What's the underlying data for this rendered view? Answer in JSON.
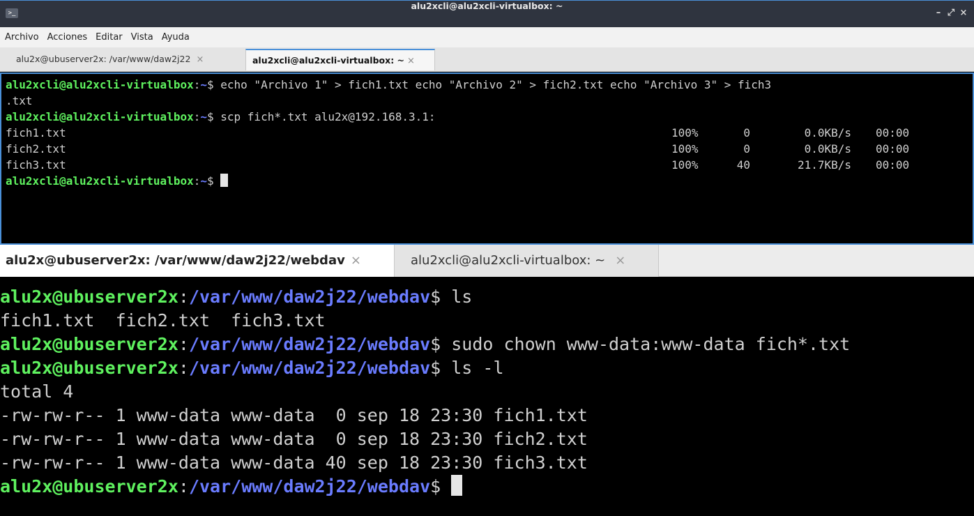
{
  "window1": {
    "title": "alu2xcli@alu2xcli-virtualbox: ~",
    "app_icon_text": ">_",
    "controls": {
      "minimize": "–",
      "maximize": "⤢",
      "close": "×"
    },
    "menu": [
      "Archivo",
      "Acciones",
      "Editar",
      "Vista",
      "Ayuda"
    ],
    "tabs": [
      {
        "label": "alu2x@ubuserver2x: /var/www/daw2j22",
        "active": false
      },
      {
        "label": "alu2xcli@alu2xcli-virtualbox: ~",
        "active": true
      }
    ],
    "tab_close": "×",
    "terminal": {
      "prompt_user": "alu2xcli@alu2xcli-virtualbox",
      "prompt_path": "~",
      "prompt_sep": ":",
      "prompt_end": "$ ",
      "cmd1": "echo \"Archivo 1\" > fich1.txt echo \"Archivo 2\" > fich2.txt echo \"Archivo 3\" > fich3",
      "cmd1_wrap": ".txt",
      "cmd2": "scp fich*.txt alu2x@192.168.3.1:",
      "transfers": [
        {
          "file": "fich1.txt",
          "pct": "100%",
          "bytes": "0",
          "rate": "0.0KB/s",
          "time": "00:00"
        },
        {
          "file": "fich2.txt",
          "pct": "100%",
          "bytes": "0",
          "rate": "0.0KB/s",
          "time": "00:00"
        },
        {
          "file": "fich3.txt",
          "pct": "100%",
          "bytes": "40",
          "rate": "21.7KB/s",
          "time": "00:00"
        }
      ]
    }
  },
  "window2": {
    "tabs": [
      {
        "label": "alu2x@ubuserver2x: /var/www/daw2j22/webdav",
        "active": true
      },
      {
        "label": "alu2xcli@alu2xcli-virtualbox: ~",
        "active": false
      }
    ],
    "tab_close": "×",
    "terminal": {
      "prompt_user": "alu2x@ubuserver2x",
      "prompt_sep": ":",
      "prompt_path": "/var/www/daw2j22/webdav",
      "prompt_end": "$ ",
      "cmd1": "ls",
      "ls_output": "fich1.txt  fich2.txt  fich3.txt",
      "cmd2": "sudo chown www-data:www-data fich*.txt",
      "cmd3": "ls -l",
      "total": "total 4",
      "listing": [
        "-rw-rw-r-- 1 www-data www-data  0 sep 18 23:30 fich1.txt",
        "-rw-rw-r-- 1 www-data www-data  0 sep 18 23:30 fich2.txt",
        "-rw-rw-r-- 1 www-data www-data 40 sep 18 23:30 fich3.txt"
      ]
    }
  },
  "colors": {
    "prompt_user": "#5ff25f",
    "prompt_path": "#6a7cff",
    "accent": "#4a90d9",
    "titlebar": "#2f343f"
  }
}
